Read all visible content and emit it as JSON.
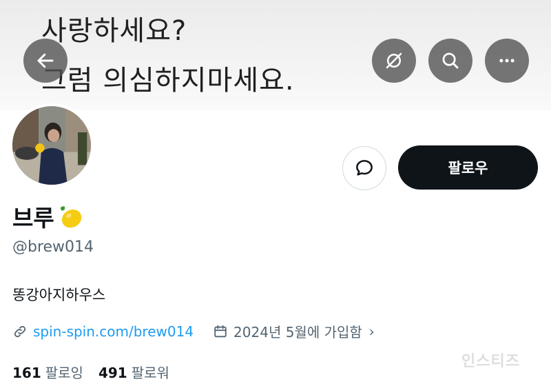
{
  "banner": {
    "line1": "사랑하세요?",
    "line2": "그럼 의심하지마세요."
  },
  "top_bar": {
    "back_icon": "arrow-left-icon",
    "translate_icon": "translate-slash-icon",
    "search_icon": "search-icon",
    "more_icon": "more-horizontal-icon"
  },
  "profile": {
    "display_name": "브루",
    "name_emoji": "lemon-icon",
    "handle": "@brew014",
    "bio": "똥강아지하우스",
    "link": "spin-spin.com/brew014",
    "joined": "2024년 5월에 가입함",
    "following_count": "161",
    "following_label": "팔로잉",
    "followers_count": "491",
    "followers_label": "팔로워"
  },
  "actions": {
    "follow_label": "팔로우",
    "message_icon": "message-bubble-icon"
  },
  "watermark": "인스티즈",
  "colors": {
    "accent_link": "#1d9bf0",
    "primary_text": "#0f1419",
    "secondary_text": "#536471",
    "follow_button_bg": "#0f1419"
  }
}
